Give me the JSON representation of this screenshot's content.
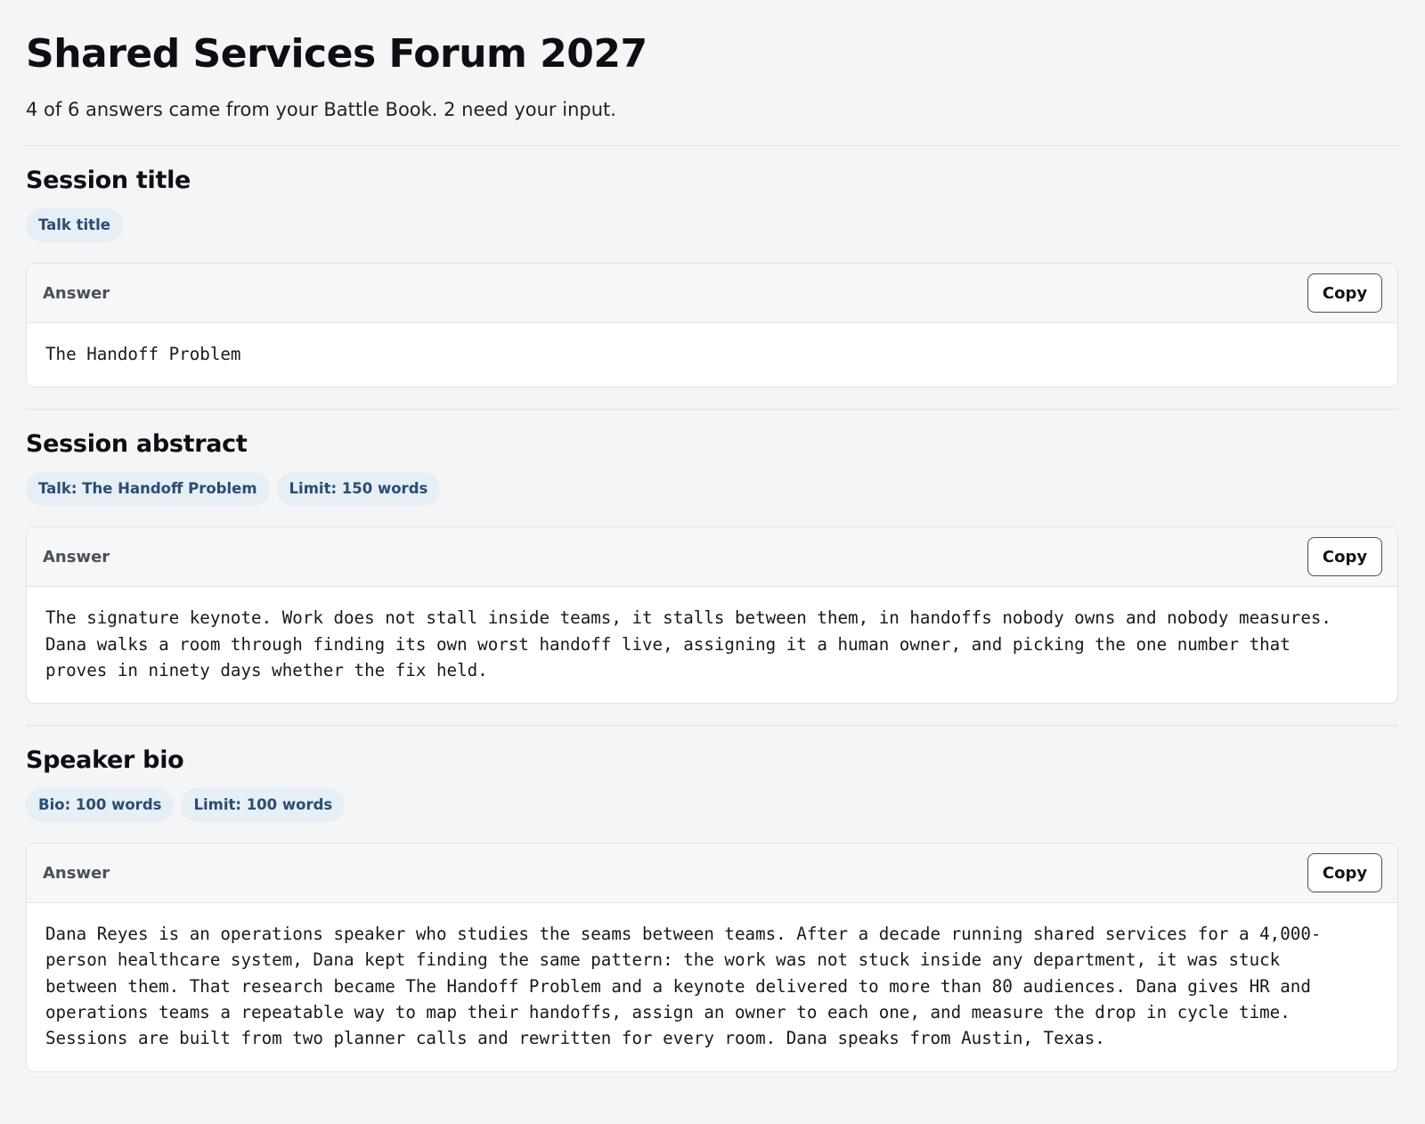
{
  "page": {
    "title": "Shared Services Forum 2027",
    "subtitle": "4 of 6 answers came from your Battle Book. 2 need your input."
  },
  "sections": [
    {
      "title": "Session title",
      "tags": [
        "Talk title"
      ],
      "answer_label": "Answer",
      "copy_label": "Copy",
      "answer": "The Handoff Problem"
    },
    {
      "title": "Session abstract",
      "tags": [
        "Talk: The Handoff Problem",
        "Limit: 150 words"
      ],
      "answer_label": "Answer",
      "copy_label": "Copy",
      "answer": "The signature keynote. Work does not stall inside teams, it stalls between them, in handoffs nobody owns and nobody measures.\nDana walks a room through finding its own worst handoff live, assigning it a human owner, and picking the one number that\nproves in ninety days whether the fix held."
    },
    {
      "title": "Speaker bio",
      "tags": [
        "Bio: 100 words",
        "Limit: 100 words"
      ],
      "answer_label": "Answer",
      "copy_label": "Copy",
      "answer": "Dana Reyes is an operations speaker who studies the seams between teams. After a decade running shared services for a 4,000-\nperson healthcare system, Dana kept finding the same pattern: the work was not stuck inside any department, it was stuck\nbetween them. That research became The Handoff Problem and a keynote delivered to more than 80 audiences. Dana gives HR and\noperations teams a repeatable way to map their handoffs, assign an owner to each one, and measure the drop in cycle time.\nSessions are built from two planner calls and rewritten for every room. Dana speaks from Austin, Texas."
    }
  ]
}
